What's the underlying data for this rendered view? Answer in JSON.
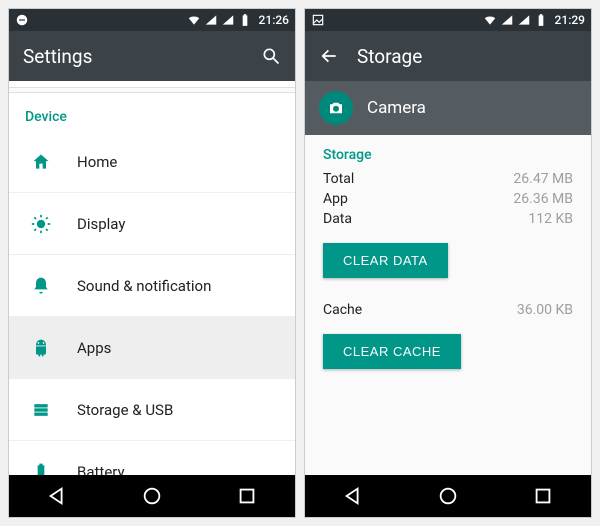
{
  "left": {
    "statusbar": {
      "time": "21:26"
    },
    "actionbar": {
      "title": "Settings"
    },
    "section_label": "Device",
    "items": [
      {
        "label": "Home"
      },
      {
        "label": "Display"
      },
      {
        "label": "Sound & notification"
      },
      {
        "label": "Apps"
      },
      {
        "label": "Storage & USB"
      },
      {
        "label": "Battery"
      }
    ]
  },
  "right": {
    "statusbar": {
      "time": "21:29"
    },
    "actionbar": {
      "title": "Storage"
    },
    "app_band": {
      "name": "Camera"
    },
    "section_label": "Storage",
    "total": {
      "label": "Total",
      "value": "26.47 MB"
    },
    "app": {
      "label": "App",
      "value": "26.36 MB"
    },
    "data": {
      "label": "Data",
      "value": "112 KB"
    },
    "cache": {
      "label": "Cache",
      "value": "36.00 KB"
    },
    "clear_data_label": "CLEAR DATA",
    "clear_cache_label": "CLEAR CACHE"
  }
}
